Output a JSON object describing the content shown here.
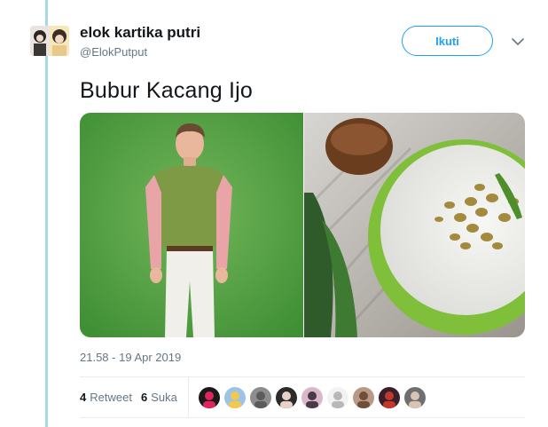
{
  "tweet": {
    "author_name": "elok kartika putri",
    "author_handle": "@ElokPutput",
    "follow_label": "Ikuti",
    "text": "Bubur Kacang Ijo",
    "timestamp": "21.58 - 19 Apr 2019",
    "retweet_count": "4",
    "retweet_label": "Retweet",
    "like_count": "6",
    "like_label": "Suka"
  },
  "colors": {
    "accent": "#1da1f2",
    "thread_line": "#a6d9e5",
    "muted_text": "#657786"
  },
  "icons": {
    "menu": "chevron-down-icon"
  },
  "likers": [
    {
      "name": "liker-avatar-1",
      "bg": "#1a1a1a",
      "fg": "#e0245e"
    },
    {
      "name": "liker-avatar-2",
      "bg": "#9ec3e6",
      "fg": "#f2c94c"
    },
    {
      "name": "liker-avatar-3",
      "bg": "#8d8d8d",
      "fg": "#5b5b5b"
    },
    {
      "name": "liker-avatar-4",
      "bg": "#2b2b2b",
      "fg": "#e8d2c8"
    },
    {
      "name": "liker-avatar-5",
      "bg": "#d9b8c9",
      "fg": "#4b3a47"
    },
    {
      "name": "liker-avatar-6",
      "bg": "#f3f3f3",
      "fg": "#b8b8b8"
    },
    {
      "name": "liker-avatar-7",
      "bg": "#b89a86",
      "fg": "#6d4f3c"
    },
    {
      "name": "liker-avatar-8",
      "bg": "#3a1f2a",
      "fg": "#c0392b"
    },
    {
      "name": "liker-avatar-9",
      "bg": "#6f6f6f",
      "fg": "#d7c4b5"
    }
  ]
}
